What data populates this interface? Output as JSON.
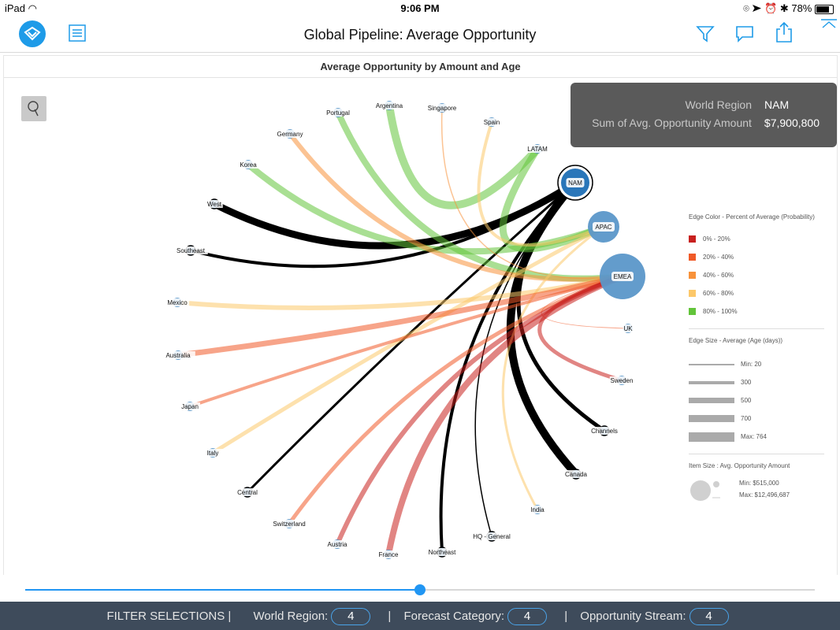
{
  "status": {
    "device": "iPad",
    "time": "9:06 PM",
    "battery": "78%"
  },
  "nav": {
    "title": "Global Pipeline: Average Opportunity"
  },
  "chart_title": "Average Opportunity by Amount and Age",
  "tooltip": {
    "row1_label": "World Region",
    "row1_value": "NAM",
    "row2_label": "Sum of Avg. Opportunity Amount",
    "row2_value": "$7,900,800"
  },
  "legend": {
    "color_title": "Edge Color - Percent of Average (Probability)",
    "color_items": [
      {
        "label": "0% - 20%",
        "color": "#c8201e"
      },
      {
        "label": "20% - 40%",
        "color": "#f05a28"
      },
      {
        "label": "40% - 60%",
        "color": "#f8923a"
      },
      {
        "label": "60% - 80%",
        "color": "#fcc86a"
      },
      {
        "label": "80% - 100%",
        "color": "#62c43a"
      }
    ],
    "size_title": "Edge Size - Average (Age (days))",
    "size_items": [
      "Min: 20",
      "300",
      "500",
      "700",
      "Max: 764"
    ],
    "item_title": "Item Size : Avg. Opportunity Amount",
    "item_min": "Min: $515,000",
    "item_max": "Max: $12,496,687"
  },
  "filters": {
    "label": "FILTER SELECTIONS |",
    "items": [
      {
        "name": "World Region:",
        "value": "4"
      },
      {
        "name": "Forecast Category:",
        "value": "4"
      },
      {
        "name": "Opportunity Stream:",
        "value": "4"
      }
    ]
  },
  "slider": {
    "value": 0.5
  },
  "chart_data": {
    "type": "network",
    "hubs": [
      "NAM",
      "APAC",
      "EMEA"
    ],
    "nodes": [
      "Argentina",
      "Singapore",
      "Portugal",
      "Spain",
      "Germany",
      "LATAM",
      "Korea",
      "NAM",
      "West",
      "APAC",
      "Southeast",
      "EMEA",
      "Mexico",
      "UK",
      "Australia",
      "Sweden",
      "Japan",
      "Channels",
      "Italy",
      "Canada",
      "Central",
      "India",
      "Switzerland",
      "HQ - General",
      "Austria",
      "Northeast",
      "France"
    ],
    "edges": [
      {
        "from": "West",
        "to": "NAM",
        "color": "#000000"
      },
      {
        "from": "Southeast",
        "to": "NAM",
        "color": "#000000"
      },
      {
        "from": "Central",
        "to": "NAM",
        "color": "#000000"
      },
      {
        "from": "Northeast",
        "to": "NAM",
        "color": "#000000"
      },
      {
        "from": "HQ - General",
        "to": "NAM",
        "color": "#000000"
      },
      {
        "from": "Canada",
        "to": "NAM",
        "color": "#000000"
      },
      {
        "from": "Channels",
        "to": "NAM",
        "color": "#000000"
      },
      {
        "from": "Argentina",
        "to": "LATAM",
        "color": "#62c43a"
      },
      {
        "from": "Portugal",
        "to": "EMEA",
        "color": "#62c43a"
      },
      {
        "from": "Korea",
        "to": "APAC",
        "color": "#62c43a"
      },
      {
        "from": "LATAM",
        "to": "APAC",
        "color": "#62c43a"
      },
      {
        "from": "Germany",
        "to": "EMEA",
        "color": "#f8923a"
      },
      {
        "from": "Singapore",
        "to": "EMEA",
        "color": "#f8923a"
      },
      {
        "from": "Spain",
        "to": "APAC",
        "color": "#fcc86a"
      },
      {
        "from": "Mexico",
        "to": "EMEA",
        "color": "#fcc86a"
      },
      {
        "from": "Italy",
        "to": "APAC",
        "color": "#fcc86a"
      },
      {
        "from": "India",
        "to": "APAC",
        "color": "#fcc86a"
      },
      {
        "from": "Australia",
        "to": "EMEA",
        "color": "#f05a28"
      },
      {
        "from": "Japan",
        "to": "EMEA",
        "color": "#f05a28"
      },
      {
        "from": "Switzerland",
        "to": "EMEA",
        "color": "#f05a28"
      },
      {
        "from": "UK",
        "to": "EMEA",
        "color": "#f05a28"
      },
      {
        "from": "Austria",
        "to": "EMEA",
        "color": "#c8201e"
      },
      {
        "from": "France",
        "to": "EMEA",
        "color": "#c8201e"
      },
      {
        "from": "Sweden",
        "to": "EMEA",
        "color": "#c8201e"
      }
    ]
  }
}
